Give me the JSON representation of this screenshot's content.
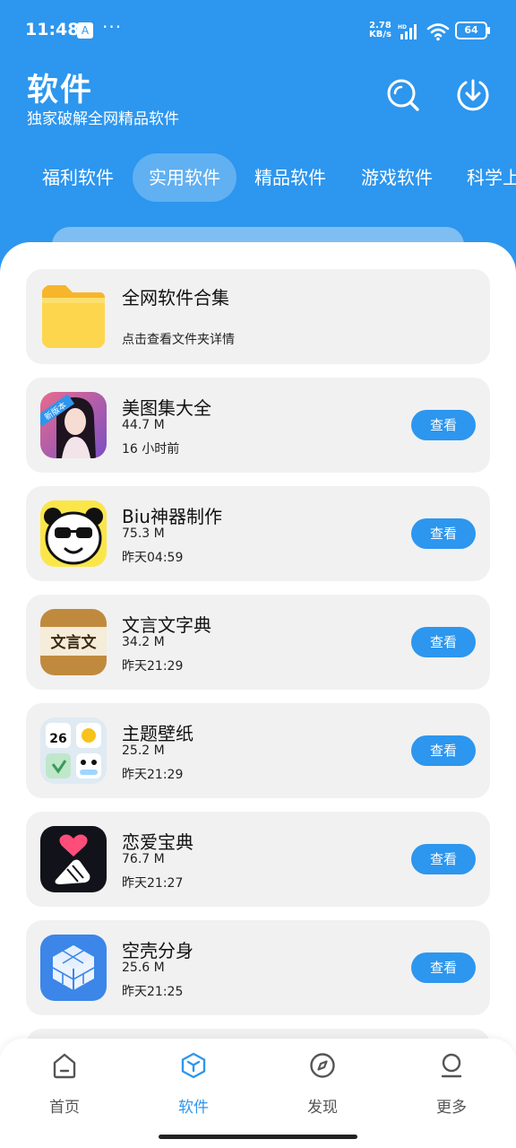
{
  "status_bar": {
    "time": "11:48",
    "app_icon": "A",
    "dots": "···",
    "net_speed_value": "2.78",
    "net_speed_unit": "KB/s",
    "hd": "HD",
    "battery": "64"
  },
  "header": {
    "title": "软件",
    "subtitle": "独家破解全网精品软件",
    "search_icon": "search-icon",
    "download_icon": "download-icon"
  },
  "tabs": [
    {
      "label": "福利软件"
    },
    {
      "label": "实用软件",
      "active": true
    },
    {
      "label": "精品软件"
    },
    {
      "label": "游戏软件"
    },
    {
      "label": "科学上"
    }
  ],
  "folder": {
    "title": "全网软件合集",
    "hint": "点击查看文件夹详情"
  },
  "apps": [
    {
      "name": "美图集大全",
      "size": "44.7 M",
      "date": "16 小时前",
      "button": "查看",
      "badge": "新版本",
      "icon": "portrait-icon"
    },
    {
      "name": "Biu神器制作",
      "size": "75.3 M",
      "date": "昨天04:59",
      "button": "查看",
      "icon": "panda-icon"
    },
    {
      "name": "文言文字典",
      "size": "34.2 M",
      "date": "昨天21:29",
      "button": "查看",
      "icon_text": "文言文",
      "icon": "scroll-icon"
    },
    {
      "name": "主题壁纸",
      "size": "25.2 M",
      "date": "昨天21:29",
      "button": "查看",
      "icon_text": "26",
      "icon": "widgets-icon"
    },
    {
      "name": "恋爱宝典",
      "size": "76.7 M",
      "date": "昨天21:27",
      "button": "查看",
      "icon": "heart-hand-icon"
    },
    {
      "name": "空壳分身",
      "size": "25.6 M",
      "date": "昨天21:25",
      "button": "查看",
      "icon": "cube-icon"
    }
  ],
  "bottom_nav": [
    {
      "label": "首页",
      "icon": "home-icon"
    },
    {
      "label": "软件",
      "icon": "box-icon",
      "active": true
    },
    {
      "label": "发现",
      "icon": "compass-icon"
    },
    {
      "label": "更多",
      "icon": "person-icon"
    }
  ],
  "colors": {
    "accent": "#2d96ee",
    "card_bg": "#f1f1f1"
  }
}
